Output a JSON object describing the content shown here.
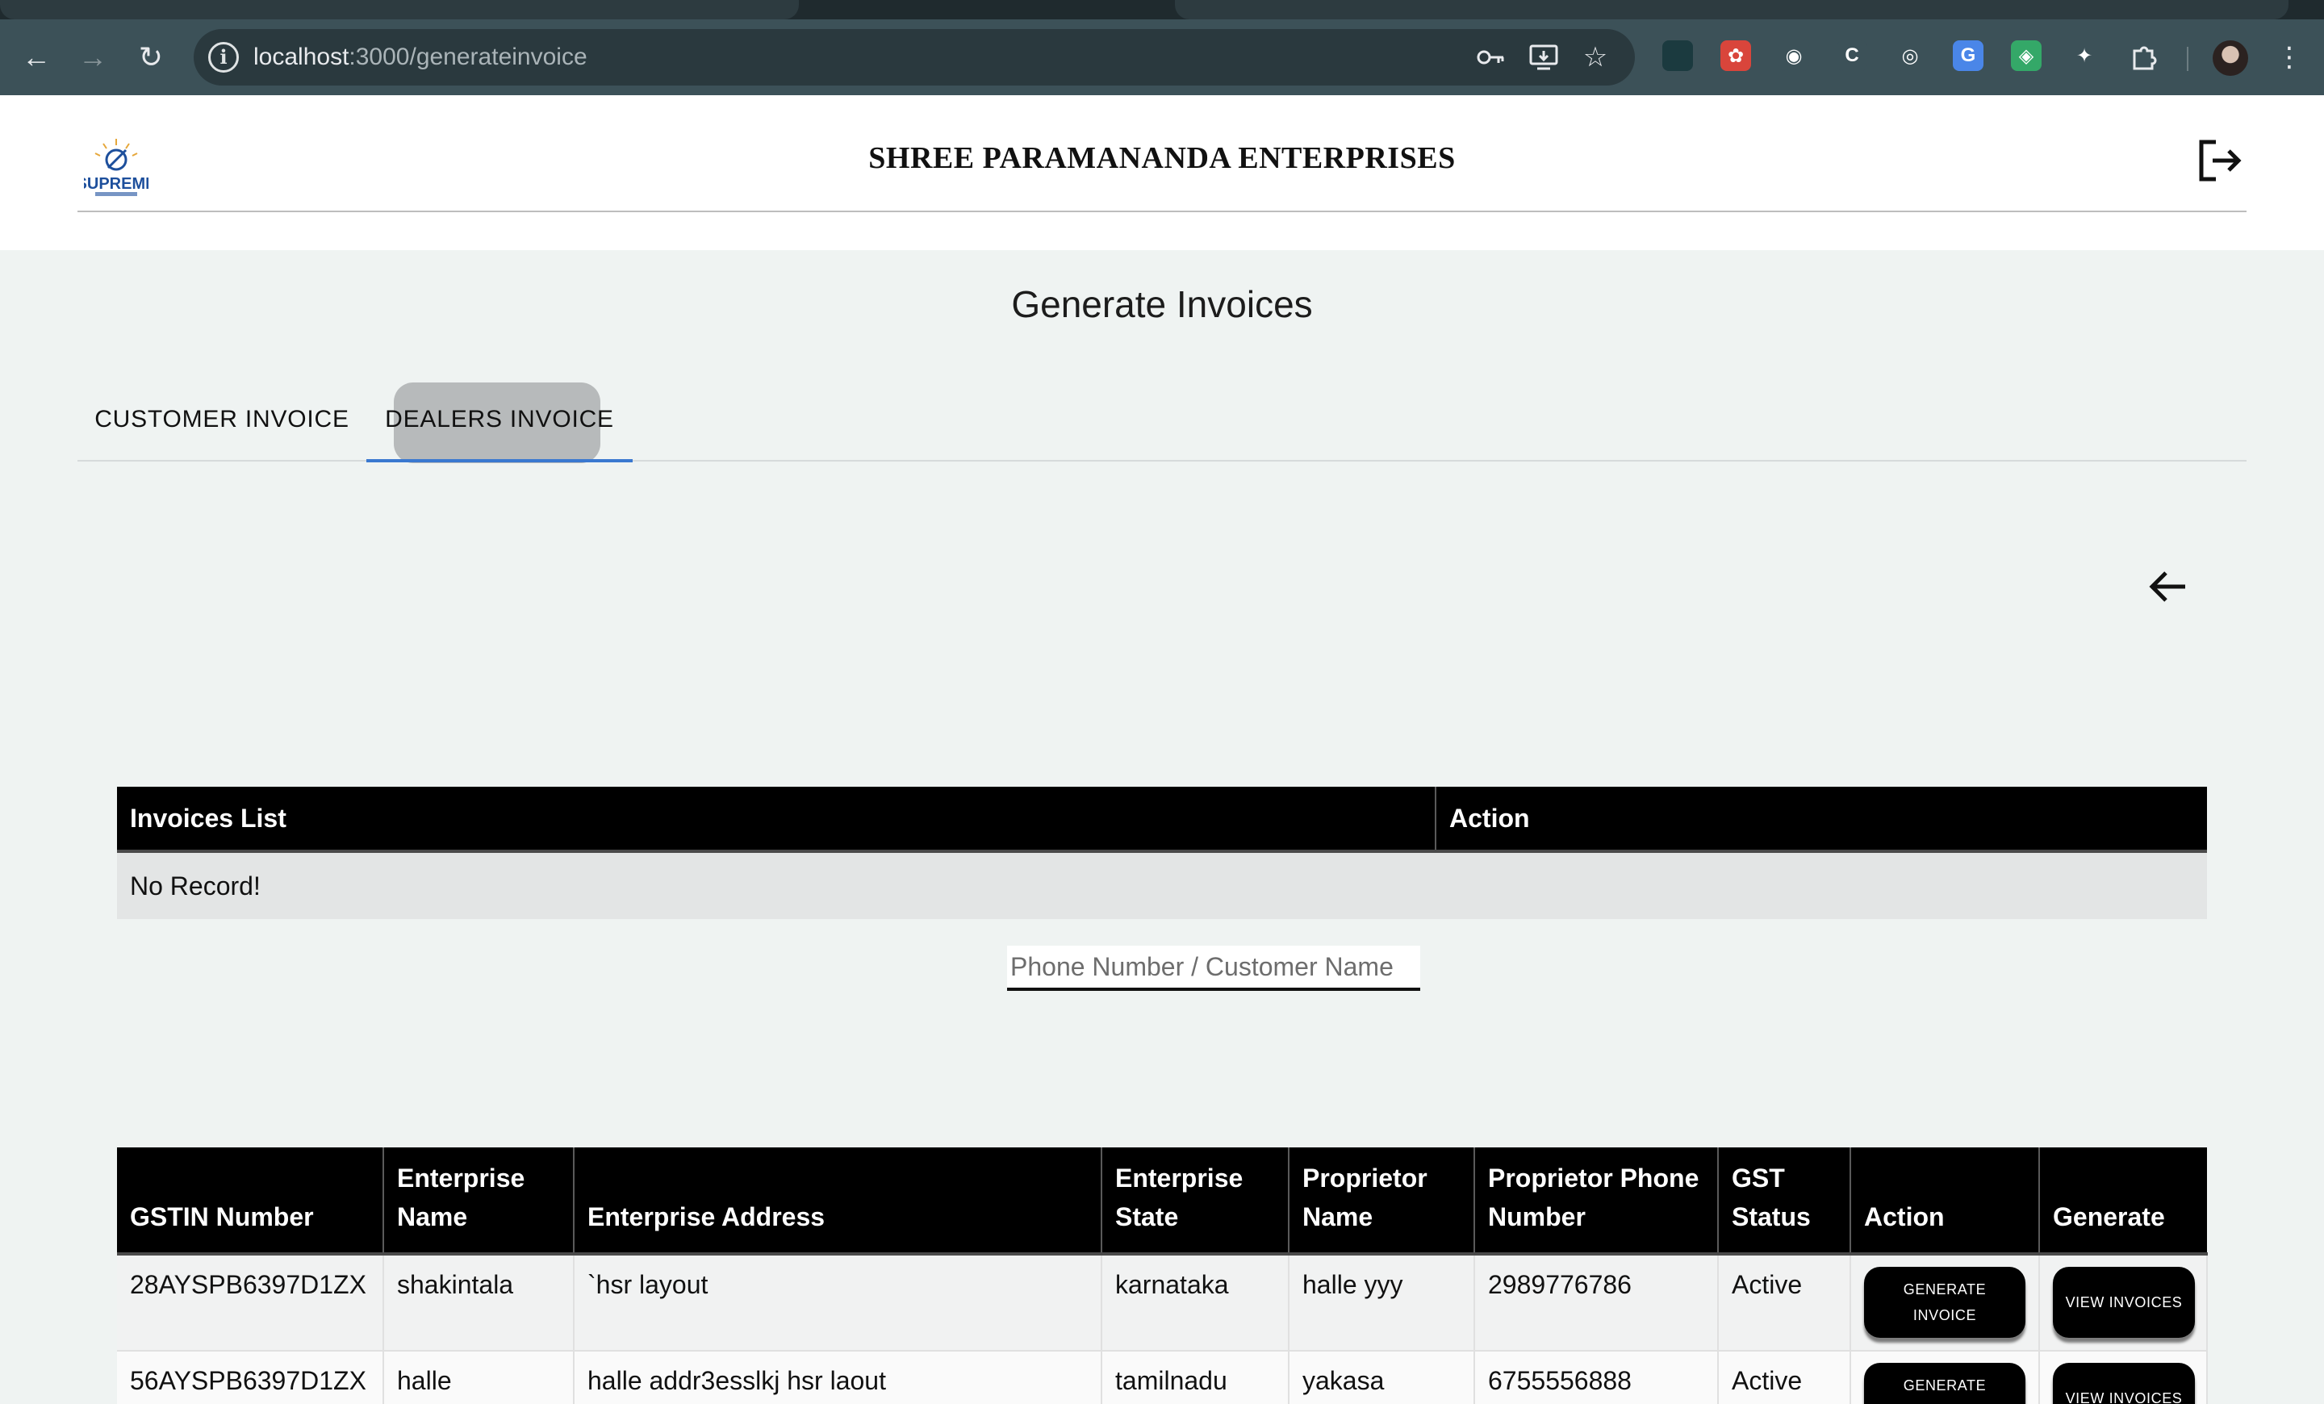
{
  "browser": {
    "url_host": "localhost",
    "url_path": ":3000/generateinvoice",
    "nav": {
      "back_icon": "←",
      "forward_icon": "→",
      "reload_icon": "↻"
    },
    "extensions": [
      {
        "name": "extension-1",
        "color": "#1b3a3f",
        "glyph": ""
      },
      {
        "name": "extension-2",
        "color": "#d9453b",
        "glyph": "✿"
      },
      {
        "name": "extension-3",
        "color": "#3c5158",
        "glyph": "◉"
      },
      {
        "name": "extension-4",
        "color": "#3c5158",
        "glyph": "C"
      },
      {
        "name": "extension-5",
        "color": "#3c5158",
        "glyph": "◎"
      },
      {
        "name": "extension-6",
        "color": "#4a86e8",
        "glyph": "G"
      },
      {
        "name": "extension-7",
        "color": "#34a868",
        "glyph": "◈"
      },
      {
        "name": "extension-8",
        "color": "#3c5158",
        "glyph": "✦"
      }
    ]
  },
  "header": {
    "logo_text": "SUPREME",
    "company_name": "SHREE PARAMANANDA ENTERPRISES"
  },
  "page": {
    "title": "Generate Invoices",
    "tabs": [
      "CUSTOMER INVOICE",
      "DEALERS INVOICE"
    ],
    "active_tab": 1
  },
  "invoices": {
    "headers": [
      "Invoices List",
      "Action"
    ],
    "empty_text": "No Record!"
  },
  "search": {
    "placeholder": "Phone Number / Customer Name"
  },
  "dealers": {
    "headers": [
      "GSTIN Number",
      "Enterprise Name",
      "Enterprise Address",
      "Enterprise State",
      "Proprietor Name",
      "Proprietor Phone Number",
      "GST Status",
      "Action",
      "Generate"
    ],
    "rows": [
      {
        "gstin": "28AYSPB6397D1ZX",
        "enterprise_name": "shakintala",
        "address": "`hsr layout",
        "state": "karnataka",
        "proprietor": "halle yyy",
        "phone": "2989776786",
        "gst_status": "Active",
        "action_label": "GENERATE INVOICE",
        "generate_label": "VIEW INVOICES"
      },
      {
        "gstin": "56AYSPB6397D1ZX",
        "enterprise_name": "halle",
        "address": "halle addr3esslkj hsr laout",
        "state": "tamilnadu",
        "proprietor": "yakasa",
        "phone": "6755556888",
        "gst_status": "Active",
        "action_label": "GENERATE INVOICE",
        "generate_label": "VIEW INVOICES"
      }
    ]
  },
  "colors": {
    "chrome": "#3c5158",
    "page_bg": "#eff3f2",
    "header_cell": "#000000",
    "tab_indicator": "#3a78d0"
  }
}
